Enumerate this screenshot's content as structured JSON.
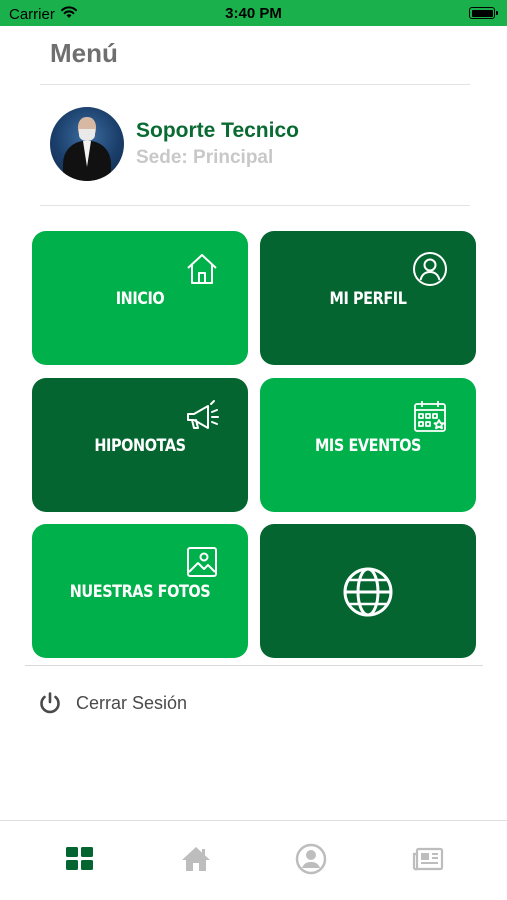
{
  "status_bar": {
    "carrier": "Carrier",
    "time": "3:40 PM",
    "wifi_icon": "wifi-icon",
    "battery_icon": "battery-icon"
  },
  "menu": {
    "title": "Menú"
  },
  "profile": {
    "name": "Soporte Tecnico",
    "branch": "Sede: Principal"
  },
  "tiles": [
    {
      "label": "INICIO",
      "icon": "home-icon",
      "style": "light"
    },
    {
      "label": "MI PERFIL",
      "icon": "user-circle-icon",
      "style": "dark"
    },
    {
      "label": "HIPONOTAS",
      "icon": "megaphone-icon",
      "style": "dark"
    },
    {
      "label": "MIS EVENTOS",
      "icon": "calendar-icon",
      "style": "light"
    },
    {
      "label": "NUESTRAS FOTOS",
      "icon": "image-icon",
      "style": "light"
    },
    {
      "label": "",
      "icon": "globe-icon",
      "style": "dark"
    }
  ],
  "logout": {
    "label": "Cerrar Sesión",
    "icon": "power-icon"
  },
  "tabbar": [
    {
      "icon": "grid-icon",
      "active": true
    },
    {
      "icon": "home-icon",
      "active": false
    },
    {
      "icon": "user-icon",
      "active": false
    },
    {
      "icon": "news-icon",
      "active": false
    }
  ],
  "colors": {
    "status_bar": "#1ab14c",
    "tile_light": "#00b04a",
    "tile_dark": "#056530",
    "profile_name": "#0a6b32",
    "tab_active": "#056530",
    "tab_inactive": "#bdbdbd"
  }
}
